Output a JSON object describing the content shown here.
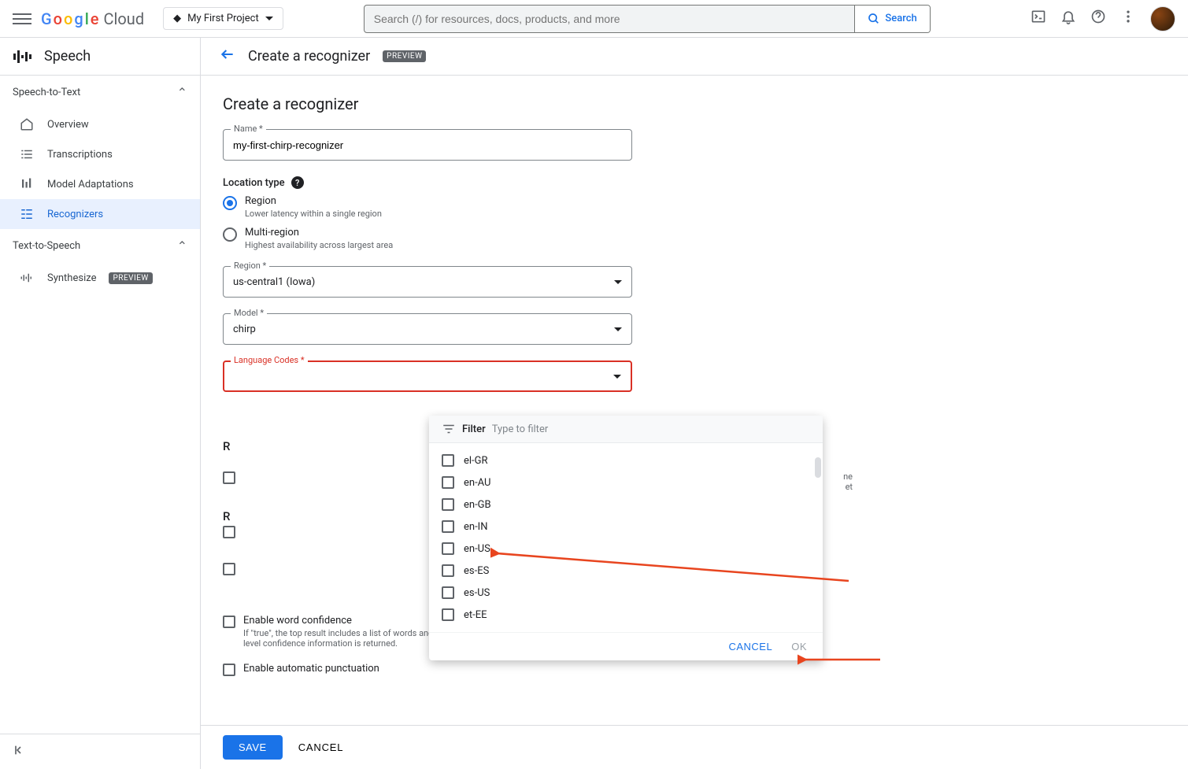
{
  "header": {
    "logo_text": "Google",
    "logo_cloud": "Cloud",
    "project_name": "My First Project",
    "search_placeholder": "Search (/) for resources, docs, products, and more",
    "search_button": "Search"
  },
  "sidebar": {
    "product_name": "Speech",
    "sections": {
      "stt": {
        "label": "Speech-to-Text"
      },
      "tts": {
        "label": "Text-to-Speech"
      }
    },
    "items": {
      "overview": "Overview",
      "transcriptions": "Transcriptions",
      "model_adaptations": "Model Adaptations",
      "recognizers": "Recognizers",
      "synthesize": "Synthesize",
      "synthesize_badge": "PREVIEW"
    }
  },
  "page": {
    "title": "Create a recognizer",
    "badge": "PREVIEW"
  },
  "form": {
    "title": "Create a recognizer",
    "name_label": "Name *",
    "name_value": "my-first-chirp-recognizer",
    "location_type_label": "Location type",
    "region_option": {
      "title": "Region",
      "sub": "Lower latency within a single region"
    },
    "multi_option": {
      "title": "Multi-region",
      "sub": "Highest availability across largest area"
    },
    "region_label": "Region *",
    "region_value": "us-central1 (Iowa)",
    "model_label": "Model *",
    "model_value": "chirp",
    "lang_label": "Language Codes *",
    "partial_r1": "R",
    "partial_r2": "R",
    "partial_text1": "ne",
    "partial_text2": "et",
    "word_conf": {
      "title": "Enable word confidence",
      "sub": "If \"true\", the top result includes a list of words and the confidence for those words. If \"false\", no word-level confidence information is returned."
    },
    "auto_punct": {
      "title": "Enable automatic punctuation"
    }
  },
  "dropdown": {
    "filter_label": "Filter",
    "filter_placeholder": "Type to filter",
    "items": [
      "el-GR",
      "en-AU",
      "en-GB",
      "en-IN",
      "en-US",
      "es-ES",
      "es-US",
      "et-EE"
    ],
    "cancel": "CANCEL",
    "ok": "OK"
  },
  "actions": {
    "save": "SAVE",
    "cancel": "CANCEL"
  }
}
